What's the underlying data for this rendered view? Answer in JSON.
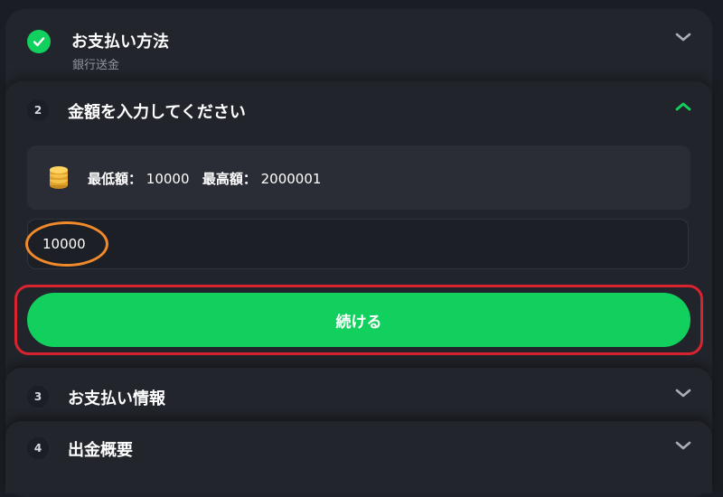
{
  "steps": [
    {
      "id": "payment-method",
      "title": "お支払い方法",
      "subtitle": "銀行送金",
      "status": "completed",
      "expanded": false
    },
    {
      "id": "amount",
      "number": "2",
      "title": "金額を入力してください",
      "expanded": true
    },
    {
      "id": "payment-info",
      "number": "3",
      "title": "お支払い情報",
      "expanded": false
    },
    {
      "id": "withdrawal-summary",
      "number": "4",
      "title": "出金概要",
      "expanded": false
    }
  ],
  "amount_form": {
    "min_label": "最低額：",
    "min_value": "10000",
    "max_label": "最高額：",
    "max_value": "2000001",
    "input_value": "10000",
    "continue_label": "続ける"
  },
  "colors": {
    "accent_green": "#12d05d",
    "annotation_orange": "#f08a2a",
    "annotation_red": "#d9232e",
    "background": "#1a1d23",
    "panel": "#22252c"
  },
  "icons": {
    "completed": "check-circle-icon",
    "collapsed": "chevron-down-icon",
    "expanded": "chevron-up-icon",
    "limits": "coins-icon"
  }
}
